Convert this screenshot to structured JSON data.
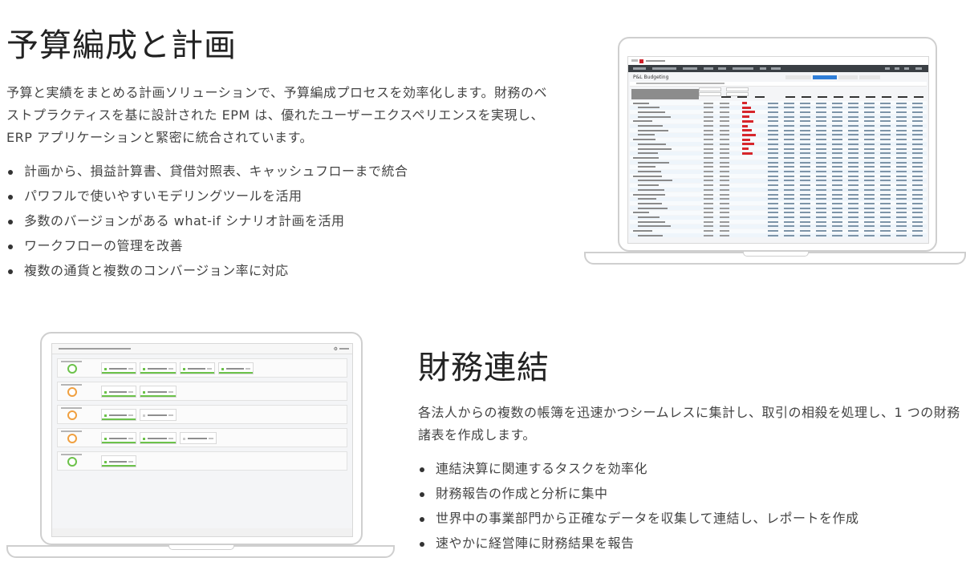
{
  "section1": {
    "heading": "予算編成と計画",
    "paragraph": "予算と実績をまとめる計画ソリューションで、予算編成プロセスを効率化します。財務のベストプラクティスを基に設計された EPM は、優れたユーザーエクスペリエンスを実現し、ERP アプリケーションと緊密に統合されています。",
    "bullets": [
      "計画から、損益計算書、貸借対照表、キャッシュフローまで統合",
      "パワフルで使いやすいモデリングツールを活用",
      "多数のバージョンがある what-if シナリオ計画を活用",
      "ワークフローの管理を改善",
      "複数の通貨と複数のコンバージョン率に対応"
    ]
  },
  "section2": {
    "heading": "財務連結",
    "paragraph": "各法人からの複数の帳簿を迅速かつシームレスに集計し、取引の相殺を処理し、1 つの財務諸表を作成します。",
    "bullets": [
      "連結決算に関連するタスクを効率化",
      "財務報告の作成と分析に集中",
      "世界中の事業部門から正確なデータを収集して連結し、レポートを作成",
      "速やかに経営陣に財務結果を報告"
    ]
  },
  "laptop1": {
    "screen_title": "P&L Budgeting",
    "accent_color": "#d7262b",
    "nav_color": "#3a3f44",
    "button_color": "#2f7ed8"
  },
  "laptop2": {
    "accent_color": "#6cc24a",
    "ring_colors": [
      "#6cc24a",
      "#f0a040",
      "#f0a040",
      "#f0a040",
      "#6cc24a"
    ],
    "gear_icon": "gear-icon"
  },
  "colors": {
    "heading": "#222222",
    "body_text": "#444444",
    "bullet": "#333333",
    "laptop_outline": "#cfcfcf"
  }
}
